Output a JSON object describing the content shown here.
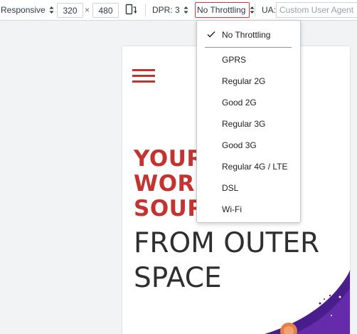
{
  "toolbar": {
    "device_label": "Responsive",
    "width_value": "320",
    "times_symbol": "×",
    "height_value": "480",
    "rotate_icon": "rotate-device-icon",
    "dpr_label": "DPR: 3",
    "throttle_label": "No Throttling",
    "ua_label": "UA:",
    "ua_placeholder": "Custom User Agent"
  },
  "throttle_menu": {
    "selected": "No Throttling",
    "items": [
      {
        "label": "No Throttling",
        "checked": true
      },
      {
        "label": "GPRS"
      },
      {
        "label": "Regular 2G"
      },
      {
        "label": "Good 2G"
      },
      {
        "label": "Regular 3G"
      },
      {
        "label": "Good 3G"
      },
      {
        "label": "Regular 4G / LTE"
      },
      {
        "label": "DSL"
      },
      {
        "label": "Wi-Fi"
      }
    ]
  },
  "page": {
    "headline_red": [
      "YOUR",
      "WORL",
      "SOUR"
    ],
    "headline_dark": [
      "FROM OUTER",
      "SPACE"
    ]
  },
  "colors": {
    "accent_red": "#c3332f",
    "headline_dark": "#2f2f2f",
    "throttle_border": "#cd3d3d",
    "planet_purple": "#4a1d8c"
  }
}
